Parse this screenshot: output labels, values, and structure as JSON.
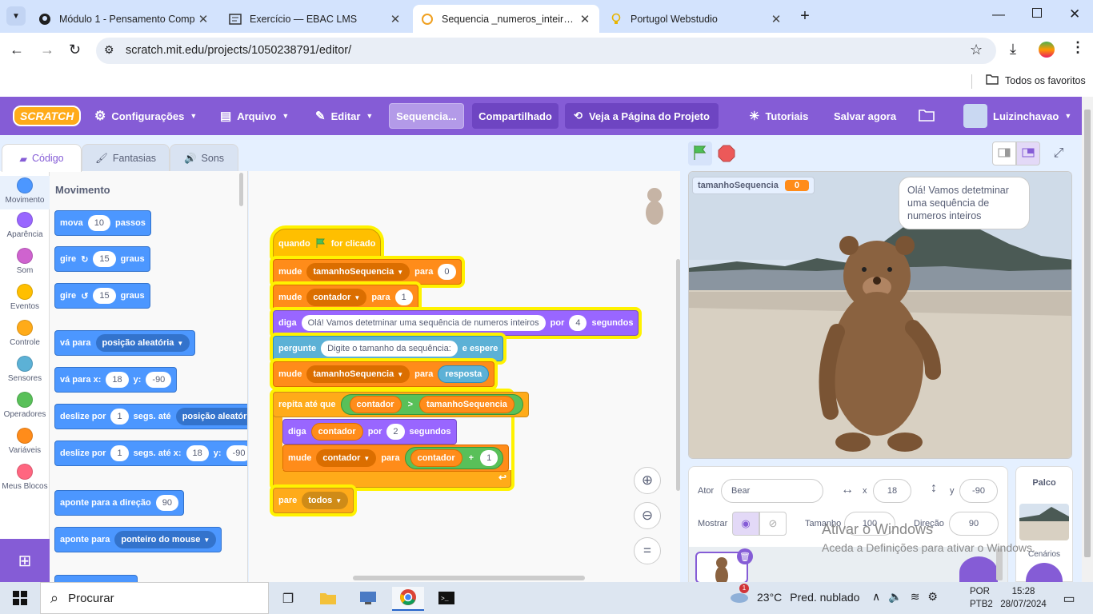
{
  "browser": {
    "tabs": [
      {
        "title": "Módulo 1 - Pensamento Comp",
        "icon": "github-icon"
      },
      {
        "title": "Exercício — EBAC LMS",
        "icon": "lms-icon"
      },
      {
        "title": "Sequencia _numeros_inteiros on",
        "icon": "scratch-icon",
        "active": true
      },
      {
        "title": "Portugol Webstudio",
        "icon": "bulb-icon"
      }
    ],
    "url": "scratch.mit.edu/projects/1050238791/editor/",
    "bookmarks_label": "Todos os favoritos"
  },
  "scratch_menu": {
    "logo": "SCRATCH",
    "settings": "Configurações",
    "file": "Arquivo",
    "edit": "Editar",
    "project_title": "Sequencia...",
    "share": "Compartilhado",
    "see_project": "Veja a Página do Projeto",
    "tutorials": "Tutoriais",
    "save_now": "Salvar agora",
    "username": "Luizinchavao"
  },
  "editor_tabs": {
    "code": "Código",
    "costumes": "Fantasias",
    "sounds": "Sons"
  },
  "categories": [
    {
      "label": "Movimento",
      "color": "#4c97ff"
    },
    {
      "label": "Aparência",
      "color": "#9966ff"
    },
    {
      "label": "Som",
      "color": "#cf63cf"
    },
    {
      "label": "Eventos",
      "color": "#ffbf00"
    },
    {
      "label": "Controle",
      "color": "#ffab19"
    },
    {
      "label": "Sensores",
      "color": "#5cb1d6"
    },
    {
      "label": "Operadores",
      "color": "#59c059"
    },
    {
      "label": "Variáveis",
      "color": "#ff8c1a"
    },
    {
      "label": "Meus Blocos",
      "color": "#ff6680"
    }
  ],
  "palette": {
    "heading": "Movimento",
    "move": {
      "a": "mova",
      "v": "10",
      "b": "passos"
    },
    "turn_right": {
      "a": "gire",
      "v": "15",
      "b": "graus"
    },
    "turn_left": {
      "a": "gire",
      "v": "15",
      "b": "graus"
    },
    "goto": {
      "a": "vá para",
      "d": "posição aleatória"
    },
    "goto_xy": {
      "a": "vá para x:",
      "x": "18",
      "y_lbl": "y:",
      "y": "-90"
    },
    "glide": {
      "a": "deslize por",
      "v": "1",
      "b": "segs. até",
      "d": "posição aleatória"
    },
    "glide_xy": {
      "a": "deslize por",
      "v": "1",
      "b": "segs. até x:",
      "x": "18",
      "y_lbl": "y:",
      "y": "-90"
    },
    "point_dir": {
      "a": "aponte para a direção",
      "v": "90"
    },
    "point_to": {
      "a": "aponte para",
      "d": "ponteiro do mouse"
    }
  },
  "script": {
    "hat": {
      "a": "quando",
      "b": "for clicado"
    },
    "set1": {
      "a": "mude",
      "var": "tamanhoSequencia",
      "b": "para",
      "v": "0"
    },
    "set2": {
      "a": "mude",
      "var": "contador",
      "b": "para",
      "v": "1"
    },
    "say_for": {
      "a": "diga",
      "text": "Olá! Vamos detetminar uma sequência de numeros inteiros",
      "b": "por",
      "v": "4",
      "c": "segundos"
    },
    "ask": {
      "a": "pergunte",
      "text": "Digite o tamanho da sequência:",
      "b": "e espere"
    },
    "set3": {
      "a": "mude",
      "var": "tamanhoSequencia",
      "b": "para",
      "rep": "resposta"
    },
    "repeat_until": {
      "a": "repita até que",
      "l": "contador",
      "op": ">",
      "r": "tamanhoSequencia"
    },
    "say2": {
      "a": "diga",
      "rep": "contador",
      "b": "por",
      "v": "2",
      "c": "segundos"
    },
    "set4": {
      "a": "mude",
      "var": "contador",
      "b": "para",
      "rep": "contador",
      "op": "+",
      "v": "1"
    },
    "stop": {
      "a": "pare",
      "d": "todos"
    }
  },
  "stage": {
    "monitor_label": "tamanhoSequencia",
    "monitor_value": "0",
    "speech": "Olá! Vamos detetminar uma sequência de numeros inteiros"
  },
  "sprite_info": {
    "actor_label": "Ator",
    "actor_name": "Bear",
    "x_label": "x",
    "x": "18",
    "y_label": "y",
    "y": "-90",
    "show_label": "Mostrar",
    "size_label": "Tamanho",
    "size": "100",
    "direction_label": "Direção",
    "direction": "90"
  },
  "stage_panel": {
    "title": "Palco",
    "backdrops": "Cenários"
  },
  "watermark": {
    "title": "Ativar o Windows",
    "subtitle": "Aceda a Definições para ativar o Windows."
  },
  "taskbar": {
    "search": "Procurar",
    "weather_temp": "23°C",
    "weather_desc": "Pred. nublado",
    "lang1": "POR",
    "lang2": "PTB2",
    "time": "15:28",
    "date": "28/07/2024",
    "weather_badge": "1"
  },
  "colors": {
    "scratch_purple": "#855cd6",
    "motion": "#4c97ff",
    "events": "#ffbf00",
    "control": "#ffab19",
    "variables": "#ff8c1a",
    "looks": "#9966ff",
    "sensing": "#5cb1d6",
    "operators": "#59c059"
  }
}
